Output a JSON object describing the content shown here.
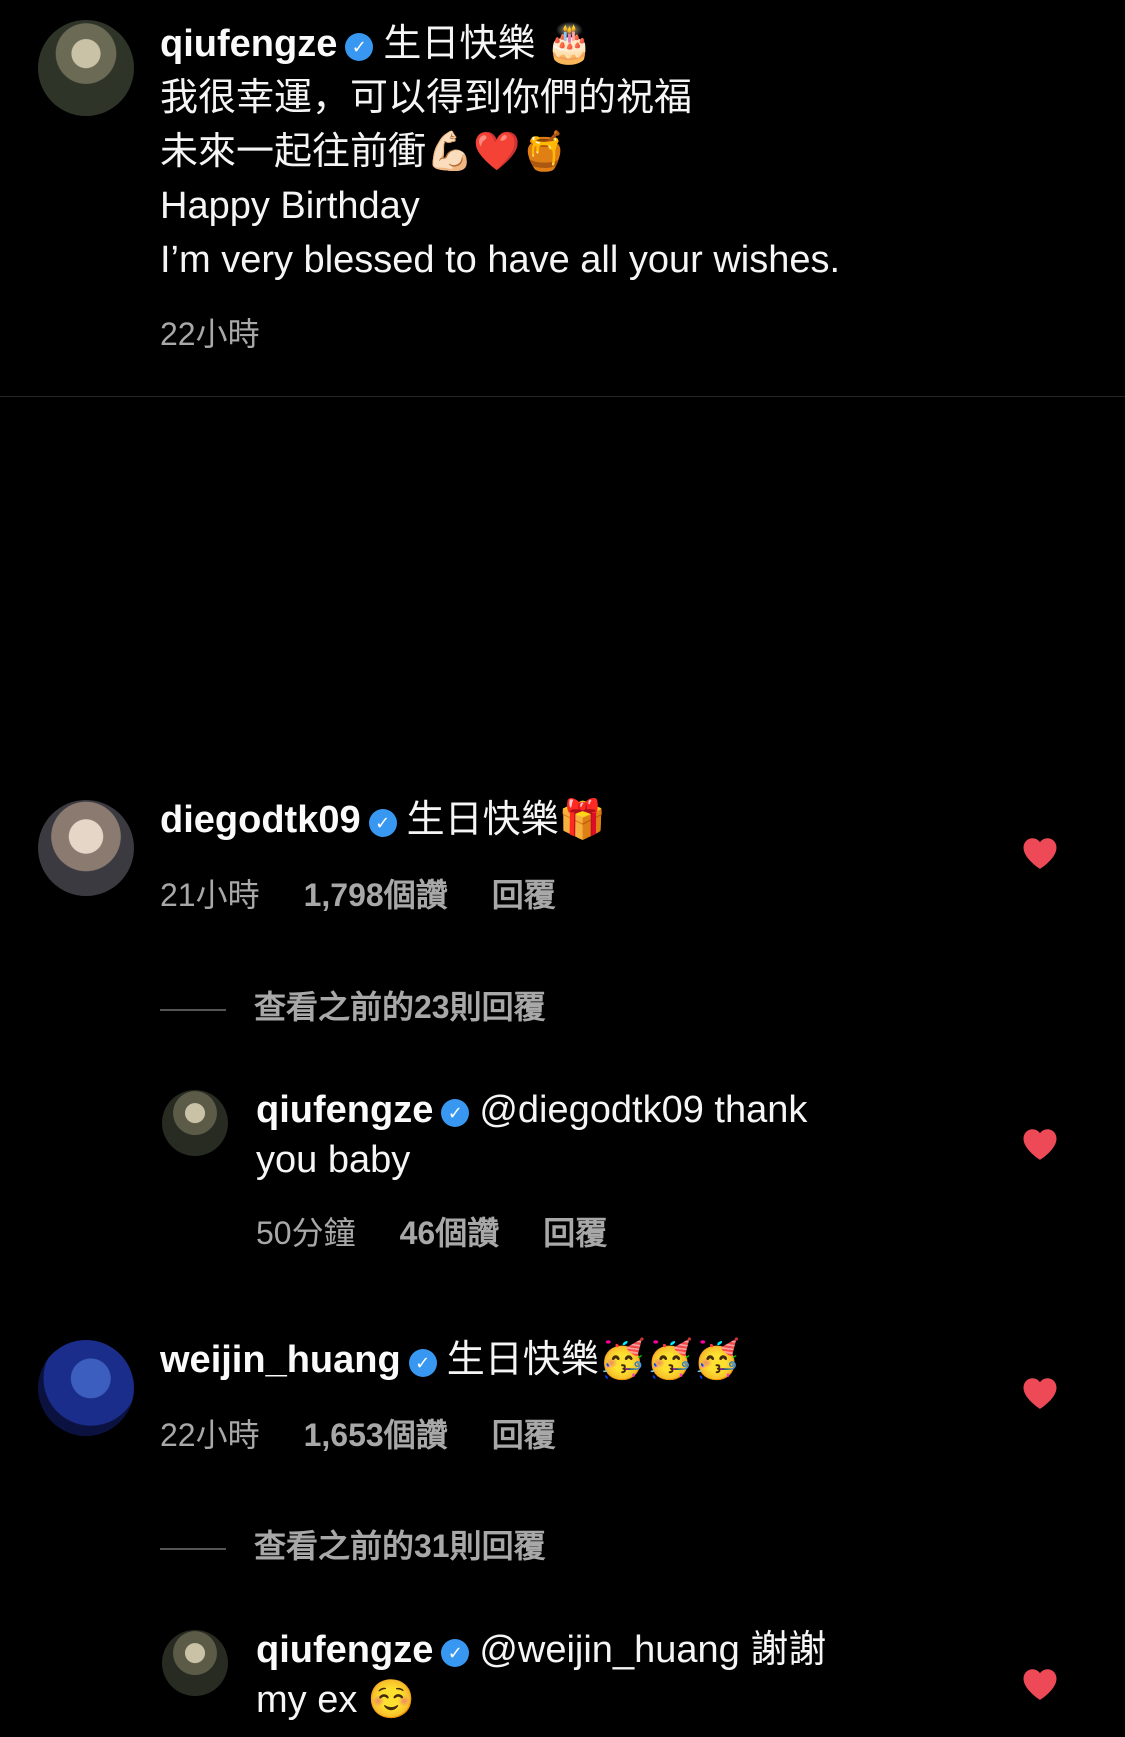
{
  "caption": {
    "username": "qiufengze",
    "line1": "生日快樂 🎂",
    "line2": "我很幸運，可以得到你們的祝福",
    "line3": "未來一起往前衝💪🏻❤️🍯",
    "line4": "Happy Birthday",
    "line5": "I’m very blessed to have all your wishes.",
    "time": "22小時"
  },
  "comments": [
    {
      "username": "diegodtk09",
      "text": "生日快樂🎁",
      "time": "21小時",
      "likes": "1,798個讚",
      "reply_label": "回覆",
      "view_replies": "查看之前的23則回覆",
      "reply": {
        "username": "qiufengze",
        "text_line1": "@diegodtk09 thank",
        "text_line2": "you baby",
        "time": "50分鐘",
        "likes": "46個讚",
        "reply_label": "回覆"
      }
    },
    {
      "username": "weijin_huang",
      "text": "生日快樂🥳🥳🥳",
      "time": "22小時",
      "likes": "1,653個讚",
      "reply_label": "回覆",
      "view_replies": "查看之前的31則回覆",
      "reply": {
        "username": "qiufengze",
        "text_line1": "@weijin_huang 謝謝",
        "text_line2": "my ex ☺️"
      }
    }
  ],
  "colors": {
    "background": "#000000",
    "text": "#f5f5f5",
    "secondary": "#a8a8a8",
    "verified": "#3897f0",
    "heart": "#ed4956"
  },
  "icons": [
    "verified-badge-icon",
    "heart-icon"
  ]
}
